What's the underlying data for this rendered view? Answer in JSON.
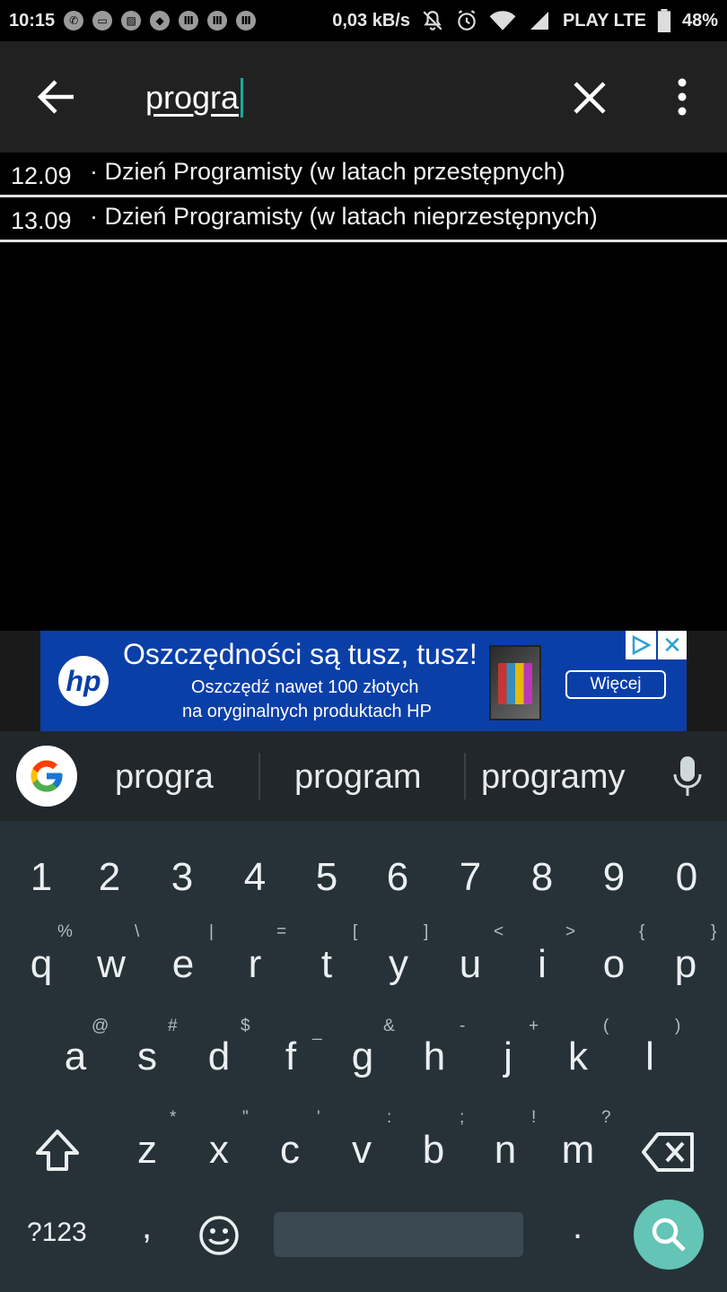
{
  "status_bar": {
    "time": "10:15",
    "network_speed": "0,03 kB/s",
    "carrier": "PLAY LTE",
    "battery": "48%"
  },
  "app_bar": {
    "search_value": "progra"
  },
  "results": [
    {
      "date": "12.09",
      "name": "· Dzień Programisty (w latach przestępnych)"
    },
    {
      "date": "13.09",
      "name": "· Dzień Programisty (w latach nieprzestępnych)"
    }
  ],
  "ad": {
    "logo": "hp",
    "headline": "Oszczędności są tusz, tusz!",
    "sub_line1": "Oszczędź nawet 100 złotych",
    "sub_line2": "na oryginalnych produktach HP",
    "cta": "Więcej"
  },
  "suggestions": [
    "progra",
    "program",
    "programy"
  ],
  "keyboard": {
    "numbers": [
      "1",
      "2",
      "3",
      "4",
      "5",
      "6",
      "7",
      "8",
      "9",
      "0"
    ],
    "row1": [
      "q",
      "w",
      "e",
      "r",
      "t",
      "y",
      "u",
      "i",
      "o",
      "p"
    ],
    "row1_hints": [
      "%",
      "\\",
      "|",
      "=",
      "[",
      "]",
      "<",
      ">",
      "{",
      "}"
    ],
    "row2": [
      "a",
      "s",
      "d",
      "f",
      "g",
      "h",
      "j",
      "k",
      "l"
    ],
    "row2_hints": [
      "@",
      "#",
      "$",
      "_",
      "&",
      "-",
      "+",
      "(",
      ")"
    ],
    "row3": [
      "z",
      "x",
      "c",
      "v",
      "b",
      "n",
      "m"
    ],
    "row3_hints": [
      "*",
      "\"",
      "'",
      ":",
      ";",
      "!",
      "?"
    ],
    "symbols_key": "?123",
    "comma": ",",
    "period": "."
  },
  "colors": {
    "app_bar": "#212121",
    "accent_caret": "#18a999",
    "keyboard_bg": "#263238",
    "search_key": "#64c4b6",
    "ad_bg": "#0b3fa8"
  }
}
